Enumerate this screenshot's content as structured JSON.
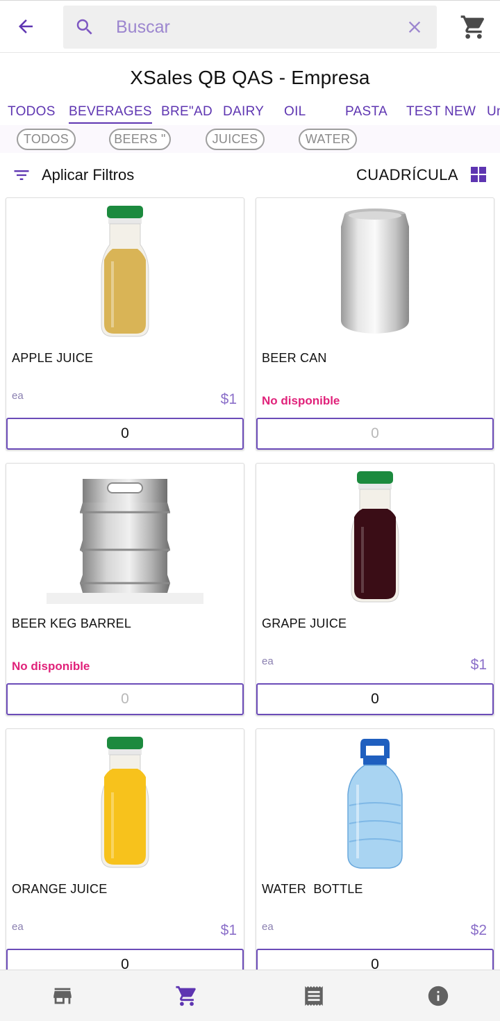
{
  "header": {
    "search_placeholder": "Buscar",
    "company_title": "XSales QB QAS - Empresa"
  },
  "categories": [
    "TODOS",
    "BEVERAGES",
    "BRE\"AD",
    "DAIRY",
    "OIL",
    "PASTA",
    "TEST NEW",
    "Un"
  ],
  "active_category": "BEVERAGES",
  "subcategories": [
    "TODOS",
    "BEERS \"",
    "JUICES",
    "WATER"
  ],
  "filters": {
    "apply_label": "Aplicar Filtros",
    "view_label": "CUADRÍCULA"
  },
  "products": [
    {
      "name": "APPLE JUICE",
      "unit": "ea",
      "price": "$1",
      "available": true,
      "qty": "0",
      "image": "juice-bottle",
      "liquid_color": "#d9b456"
    },
    {
      "name": "BEER CAN",
      "unit": "",
      "price": "",
      "available": false,
      "status": "No disponible",
      "qty": "0",
      "image": "beer-can"
    },
    {
      "name": "BEER KEG BARREL",
      "unit": "",
      "price": "",
      "available": false,
      "status": "No disponible",
      "qty": "0",
      "image": "keg"
    },
    {
      "name": "GRAPE JUICE",
      "unit": "ea",
      "price": "$1",
      "available": true,
      "qty": "0",
      "image": "juice-bottle",
      "liquid_color": "#3a0d16"
    },
    {
      "name": "ORANGE JUICE",
      "unit": "ea",
      "price": "$1",
      "available": true,
      "qty": "0",
      "image": "juice-bottle",
      "liquid_color": "#f7c21c"
    },
    {
      "name": "WATER  BOTTLE",
      "unit": "ea",
      "price": "$2",
      "available": true,
      "qty": "0",
      "image": "water-jug"
    }
  ],
  "colors": {
    "accent": "#5e35b1",
    "price": "#8b6fc9",
    "unavailable": "#e0227a"
  },
  "bottom_nav": [
    "store-icon",
    "cart-icon",
    "receipt-icon",
    "info-icon"
  ]
}
